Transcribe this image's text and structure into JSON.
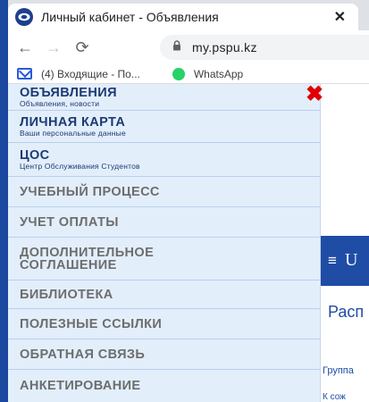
{
  "browser": {
    "tab_title": "Личный кабинет - Объявления",
    "tab_close": "✕",
    "url": "my.pspu.kz",
    "bookmarks": [
      "(4) Входящие - По...",
      "WhatsApp"
    ]
  },
  "menu": {
    "close_symbol": "✖",
    "items": [
      {
        "title": "ОБЪЯВЛЕНИЯ",
        "subtitle": "Объявления, новости"
      },
      {
        "title": "ЛИЧНАЯ КАРТА",
        "subtitle": "Ваши персональные данные"
      },
      {
        "title": "ЦОС",
        "subtitle": "Центр Обслуживания Студентов"
      },
      {
        "title": "УЧЕБНЫЙ ПРОЦЕСС"
      },
      {
        "title": "УЧЕТ ОПЛАТЫ"
      },
      {
        "title": "ДОПОЛНИТЕЛЬНОЕ СОГЛАШЕНИЕ"
      },
      {
        "title": "БИБЛИОТЕКА"
      },
      {
        "title": "ПОЛЕЗНЫЕ ССЫЛКИ"
      },
      {
        "title": "ОБРАТНАЯ СВЯЗЬ"
      },
      {
        "title": "АНКЕТИРОВАНИЕ"
      }
    ]
  },
  "background_page": {
    "menu_icon": "≡",
    "brand_letter": "U",
    "heading": "Расп",
    "group_label": "Группа",
    "more_text": "К сож"
  }
}
